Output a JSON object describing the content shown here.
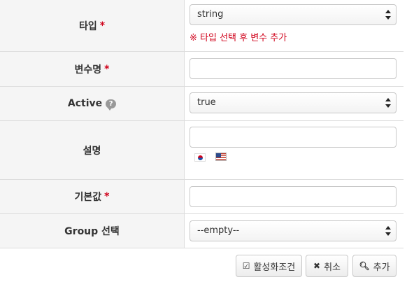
{
  "form": {
    "required_mark": "*",
    "rows": [
      {
        "label": "타입",
        "value": "string",
        "hint": "※ 타입 선택 후 변수 추가"
      },
      {
        "label": "변수명",
        "value": ""
      },
      {
        "label": "Active",
        "value": "true",
        "help_icon": "question-bubble-icon"
      },
      {
        "label": "설명",
        "value": "",
        "flags": [
          "korean-flag-icon",
          "us-flag-icon"
        ]
      },
      {
        "label": "기본값",
        "value": ""
      },
      {
        "label": "Group 선택",
        "value": "--empty--"
      }
    ]
  },
  "buttons": {
    "activate_condition": {
      "label": "활성화조건",
      "icon": "check-square-icon"
    },
    "cancel": {
      "label": "취소",
      "icon": "x-icon"
    },
    "add": {
      "label": "추가",
      "icon": "search-icon"
    }
  },
  "colors": {
    "required": "#d0021b",
    "label_bg": "#f5f5f5",
    "border": "#dddddd"
  }
}
